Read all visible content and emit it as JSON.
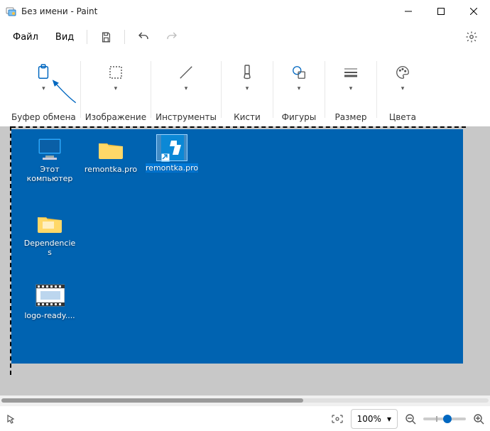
{
  "titlebar": {
    "title": "Без имени - Paint"
  },
  "menubar": {
    "file": "Файл",
    "view": "Вид"
  },
  "ribbon": {
    "groups": [
      {
        "label": "Буфер обмена"
      },
      {
        "label": "Изображение"
      },
      {
        "label": "Инструменты"
      },
      {
        "label": "Кисти"
      },
      {
        "label": "Фигуры"
      },
      {
        "label": "Размер"
      },
      {
        "label": "Цвета"
      }
    ]
  },
  "desktop_icons": {
    "this_pc": "Этот компьютер",
    "folder1": "remontka.pro",
    "shortcut1": "remontka.pro",
    "folder2": "Dependencies",
    "video1": "logo-ready...."
  },
  "status": {
    "zoom": "100%"
  }
}
